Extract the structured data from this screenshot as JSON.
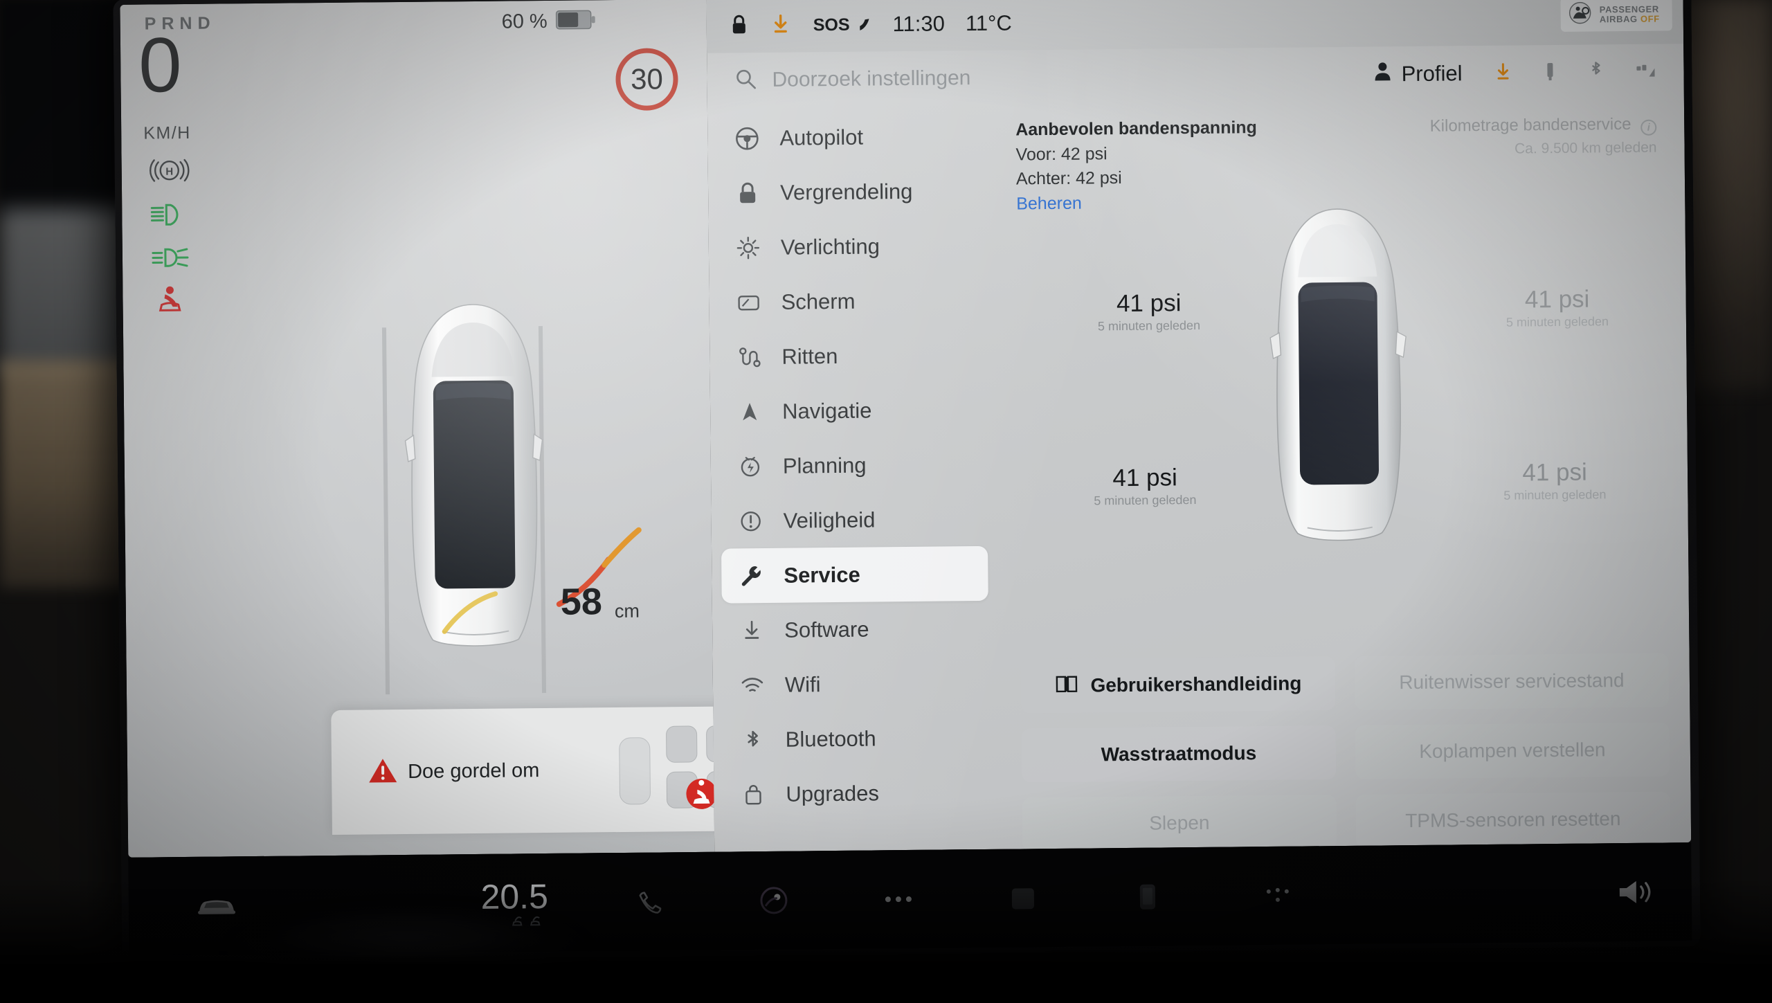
{
  "driver": {
    "gear": "PRND",
    "speed": "0",
    "speed_unit": "KM/H",
    "speed_limit": "30",
    "battery_percent": "60 %",
    "distance_value": "58",
    "distance_unit": "cm",
    "telltales": [
      {
        "name": "parking-brake-hold-icon",
        "color": "#3a3e41"
      },
      {
        "name": "low-beam-headlight-icon",
        "color": "#2faa55"
      },
      {
        "name": "front-fog-light-icon",
        "color": "#2faa55"
      },
      {
        "name": "seatbelt-warning-icon",
        "color": "#cf2b2b"
      }
    ],
    "alert": {
      "icon": "warning-triangle-icon",
      "text": "Doe gordel om",
      "accent": "#d42a24"
    }
  },
  "statusbar": {
    "lock_icon": "lock-icon",
    "download_icon": "software-download-icon",
    "sos": "SOS",
    "time": "11:30",
    "temperature": "11°C",
    "airbag": {
      "line1": "PASSENGER",
      "line2": "AIRBAG",
      "state": "OFF"
    }
  },
  "search": {
    "icon": "search-icon",
    "placeholder": "Doorzoek instellingen"
  },
  "toolbar": {
    "profile_label": "Profiel",
    "icons": [
      "profile-icon",
      "software-download-icon",
      "usb-icon",
      "bluetooth-icon",
      "cellular-signal-icon"
    ]
  },
  "sidebar": {
    "items": [
      {
        "label": "Autopilot",
        "icon": "steering-wheel-icon",
        "active": false
      },
      {
        "label": "Vergrendeling",
        "icon": "lock-icon",
        "active": false
      },
      {
        "label": "Verlichting",
        "icon": "light-bulb-icon",
        "active": false
      },
      {
        "label": "Scherm",
        "icon": "display-icon",
        "active": false
      },
      {
        "label": "Ritten",
        "icon": "trips-route-icon",
        "active": false
      },
      {
        "label": "Navigatie",
        "icon": "navigation-arrow-icon",
        "active": false
      },
      {
        "label": "Planning",
        "icon": "schedule-clock-icon",
        "active": false
      },
      {
        "label": "Veiligheid",
        "icon": "safety-alert-icon",
        "active": false
      },
      {
        "label": "Service",
        "icon": "wrench-icon",
        "active": true
      },
      {
        "label": "Software",
        "icon": "download-icon",
        "active": false
      },
      {
        "label": "Wifi",
        "icon": "wifi-icon",
        "active": false
      },
      {
        "label": "Bluetooth",
        "icon": "bluetooth-icon",
        "active": false
      },
      {
        "label": "Upgrades",
        "icon": "shopping-bag-icon",
        "active": false
      }
    ]
  },
  "service": {
    "recommended_title": "Aanbevolen bandenspanning",
    "front_label": "Voor: 42 psi",
    "rear_label": "Achter: 42 psi",
    "manage_link": "Beheren",
    "tire_service_title": "Kilometrage bandenservice",
    "tire_service_value": "Ca. 9.500 km geleden",
    "tires": [
      {
        "position": "front-left",
        "value": "41 psi",
        "time": "5 minuten geleden",
        "faded": false
      },
      {
        "position": "front-right",
        "value": "41 psi",
        "time": "5 minuten geleden",
        "faded": true
      },
      {
        "position": "rear-left",
        "value": "41 psi",
        "time": "5 minuten geleden",
        "faded": false
      },
      {
        "position": "rear-right",
        "value": "41 psi",
        "time": "5 minuten geleden",
        "faded": true
      }
    ],
    "buttons": [
      {
        "label": "Gebruikershandleiding",
        "icon": "book-icon",
        "enabled": true
      },
      {
        "label": "Ruitenwisser servicestand",
        "icon": "",
        "enabled": false
      },
      {
        "label": "Wasstraatmodus",
        "icon": "",
        "enabled": true
      },
      {
        "label": "Koplampen verstellen",
        "icon": "",
        "enabled": false
      },
      {
        "label": "Slepen",
        "icon": "",
        "enabled": false
      },
      {
        "label": "TPMS-sensoren resetten",
        "icon": "",
        "enabled": false
      }
    ]
  },
  "taskbar": {
    "car_icon": "car-front-icon",
    "driver_temp": "20.5",
    "icons": [
      "phone-icon",
      "media-voice-icon",
      "more-dots-icon",
      "camera-icon",
      "phone-app-icon",
      "climate-icon",
      "volume-icon"
    ]
  },
  "colors": {
    "accent_link": "#2f6fd0",
    "warning_red": "#d42a24",
    "telltale_green": "#2faa55",
    "speed_limit_red": "#c0392b",
    "amber": "#e08c18"
  }
}
